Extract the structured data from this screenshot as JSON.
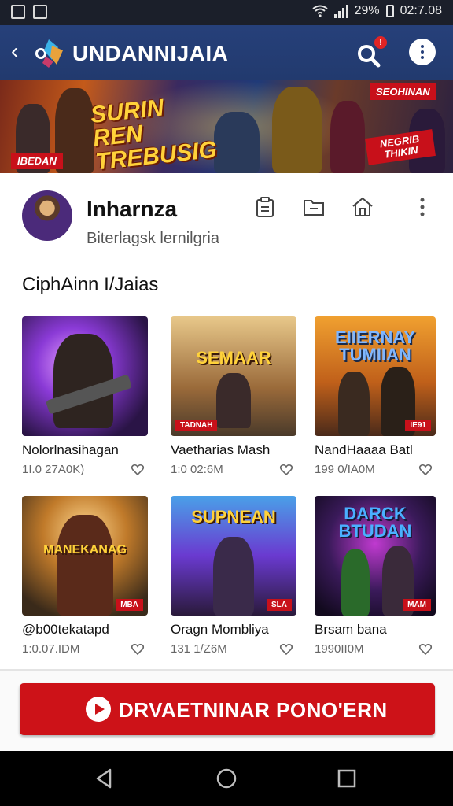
{
  "status": {
    "battery": "29%",
    "time": "02:7.08"
  },
  "appbar": {
    "title": "UNDANNIJAIA",
    "badge": "!"
  },
  "banner": {
    "title": "SURIN REN TREBUSIG",
    "tag_left": "IBEDAN",
    "tag_right_top": "SEOHINAN",
    "tag_right_bottom": "NEGRIB THIKIN"
  },
  "profile": {
    "name": "Inharnza",
    "subtitle": "Biterlagsk lernilgria"
  },
  "section": {
    "title": "CiphAinn I/Jaias"
  },
  "games": [
    {
      "name": "Nolorlnasihagan",
      "meta": "1I.0 27A0K)",
      "thumb_caption": "",
      "tag": ""
    },
    {
      "name": "Vaetharias Mash",
      "meta": "1:0 02:6M",
      "thumb_caption": "SEMAAR",
      "tag": "TADNAH"
    },
    {
      "name": "NandHaaaa Batl",
      "meta": "199 0/IA0M",
      "thumb_caption": "EIIERNAY TUMIIAN",
      "tag": "IE91"
    },
    {
      "name": "@b00tekatapd",
      "meta": "1:0.07.IDM",
      "thumb_caption": "MANEKANAG",
      "tag": "MBA"
    },
    {
      "name": "Oragn Mombliya",
      "meta": "131 1/Z6M",
      "thumb_caption": "SUPNEAN",
      "tag": "SLA"
    },
    {
      "name": "Brsam bana",
      "meta": "1990II0M",
      "thumb_caption": "DARCK BTUDAN",
      "tag": "MAM"
    }
  ],
  "cta": {
    "label": "DRVAETNINAR PONO'ERN"
  }
}
